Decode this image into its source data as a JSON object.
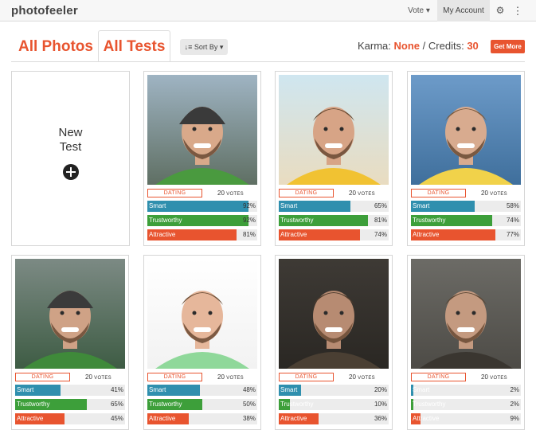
{
  "nav": {
    "logo": "photofeeler",
    "vote": "Vote ▾",
    "account": "My Account",
    "gear_icon": "⚙",
    "kebab_icon": "⋮"
  },
  "header": {
    "tab_all_photos": "All Photos",
    "tab_all_tests": "All Tests",
    "sort_by": "↓≡ Sort By ▾",
    "karma_label": "Karma:",
    "karma_value": "None",
    "separator": "/",
    "credits_label": "Credits:",
    "credits_value": "30",
    "get_more": "Get More"
  },
  "new_test": {
    "label": "New\nTest"
  },
  "tests": [
    {
      "category": "DATING",
      "votes": "20",
      "votes_unit": "VOTES",
      "smart": 92,
      "trustworthy": 92,
      "attractive": 81,
      "scene": "mountain-beanie",
      "shirt": "#4a9a3f"
    },
    {
      "category": "DATING",
      "votes": "20",
      "votes_unit": "VOTES",
      "smart": 65,
      "trustworthy": 81,
      "attractive": 74,
      "scene": "beach",
      "shirt": "#f1c232"
    },
    {
      "category": "DATING",
      "votes": "20",
      "votes_unit": "VOTES",
      "smart": 58,
      "trustworthy": 74,
      "attractive": 77,
      "scene": "lake-city",
      "shirt": "#f1d24a"
    },
    {
      "category": "DATING",
      "votes": "20",
      "votes_unit": "VOTES",
      "smart": 41,
      "trustworthy": 65,
      "attractive": 45,
      "scene": "fjord-beanie",
      "shirt": "#3f8a3a"
    },
    {
      "category": "DATING",
      "votes": "20",
      "votes_unit": "VOTES",
      "smart": 48,
      "trustworthy": 50,
      "attractive": 38,
      "scene": "white",
      "shirt": "#8fd89a"
    },
    {
      "category": "DATING",
      "votes": "20",
      "votes_unit": "VOTES",
      "smart": 20,
      "trustworthy": 10,
      "attractive": 36,
      "scene": "dark-indoor",
      "shirt": "#4a3f33"
    },
    {
      "category": "DATING",
      "votes": "20",
      "votes_unit": "VOTES",
      "smart": 2,
      "trustworthy": 2,
      "attractive": 9,
      "scene": "grey-indoor",
      "shirt": "#3a3630"
    }
  ],
  "bar_labels": {
    "smart": "Smart",
    "trustworthy": "Trustworthy",
    "attractive": "Attractive"
  },
  "colors": {
    "accent": "#e8542f",
    "smart": "#2f8fae",
    "trustworthy": "#3d9f3a",
    "attractive": "#e8542f"
  }
}
